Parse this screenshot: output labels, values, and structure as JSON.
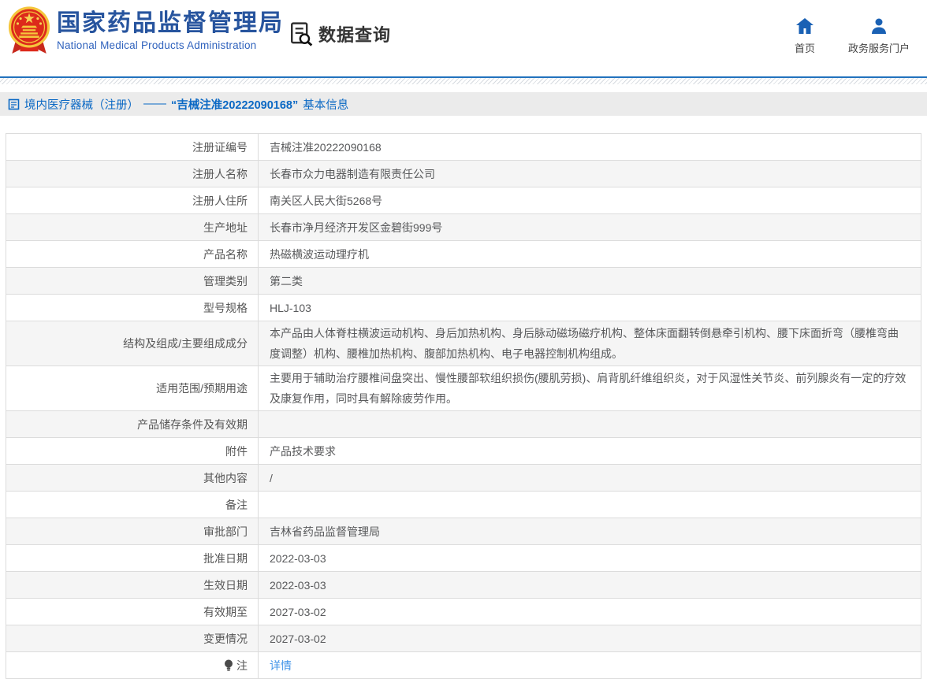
{
  "header": {
    "org_name_cn": "国家药品监督管理局",
    "org_name_en": "National Medical Products Administration",
    "section_title": "数据查询",
    "nav": [
      {
        "label": "首页",
        "icon": "home-icon"
      },
      {
        "label": "政务服务门户",
        "icon": "portal-user-icon"
      }
    ]
  },
  "breadcrumb": {
    "category": "境内医疗器械（注册）",
    "separator": "——",
    "registration_no_quoted": "“吉械注准20222090168”",
    "suffix": "基本信息"
  },
  "table": {
    "rows": [
      {
        "label": "注册证编号",
        "value": "吉械注准20222090168"
      },
      {
        "label": "注册人名称",
        "value": "长春市众力电器制造有限责任公司"
      },
      {
        "label": "注册人住所",
        "value": "南关区人民大街5268号"
      },
      {
        "label": "生产地址",
        "value": "长春市净月经济开发区金碧街999号"
      },
      {
        "label": "产品名称",
        "value": "热磁横波运动理疗机"
      },
      {
        "label": "管理类别",
        "value": "第二类"
      },
      {
        "label": "型号规格",
        "value": "HLJ-103"
      },
      {
        "label": "结构及组成/主要组成成分",
        "value": "本产品由人体脊柱横波运动机构、身后加热机构、身后脉动磁场磁疗机构、整体床面翻转倒悬牵引机构、腰下床面折弯（腰椎弯曲度调整）机构、腰椎加热机构、腹部加热机构、电子电器控制机构组成。"
      },
      {
        "label": "适用范围/预期用途",
        "value": "主要用于辅助治疗腰椎间盘突出、慢性腰部软组织损伤(腰肌劳损)、肩背肌纤维组织炎，对于风湿性关节炎、前列腺炎有一定的疗效及康复作用，同时具有解除疲劳作用。"
      },
      {
        "label": "产品储存条件及有效期",
        "value": ""
      },
      {
        "label": "附件",
        "value": "产品技术要求"
      },
      {
        "label": "其他内容",
        "value": "/"
      },
      {
        "label": "备注",
        "value": ""
      },
      {
        "label": "审批部门",
        "value": "吉林省药品监督管理局"
      },
      {
        "label": "批准日期",
        "value": "2022-03-03"
      },
      {
        "label": "生效日期",
        "value": "2022-03-03"
      },
      {
        "label": "有效期至",
        "value": "2027-03-02"
      },
      {
        "label": "变更情况",
        "value": "2027-03-02"
      },
      {
        "label": "注",
        "value": "详情",
        "link": true,
        "icon": "bulb-icon"
      }
    ]
  },
  "colors": {
    "title_blue": "#27549e",
    "subtitle_blue": "#2f62bd",
    "breadcrumb_text_blue": "#0a68c4",
    "link_blue": "#4395e8",
    "nav_icon_blue": "#1a61b4",
    "divider_blue": "#2272bd",
    "row_alt_gray": "#f5f5f5",
    "table_border": "#dcdcdc",
    "emblem_red": "#dd2a1b",
    "emblem_gold": "#f5c63c"
  }
}
